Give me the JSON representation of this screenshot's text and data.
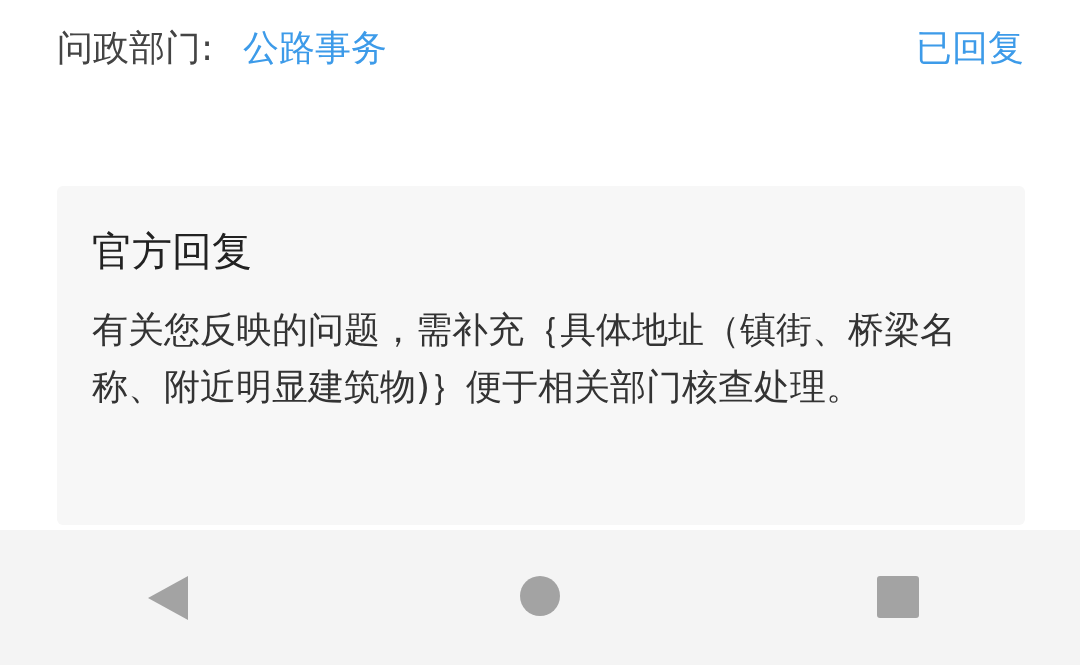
{
  "header": {
    "label": "问政部门:",
    "department": "公路事务",
    "status": "已回复"
  },
  "reply": {
    "title": "官方回复",
    "body": "有关您反映的问题，需补充｛具体地址（镇街、桥梁名称、附近明显建筑物)｝便于相关部门核查处理。"
  },
  "nav_bar": {
    "buttons": [
      {
        "kind": "back"
      },
      {
        "kind": "home"
      },
      {
        "kind": "recent"
      }
    ]
  }
}
